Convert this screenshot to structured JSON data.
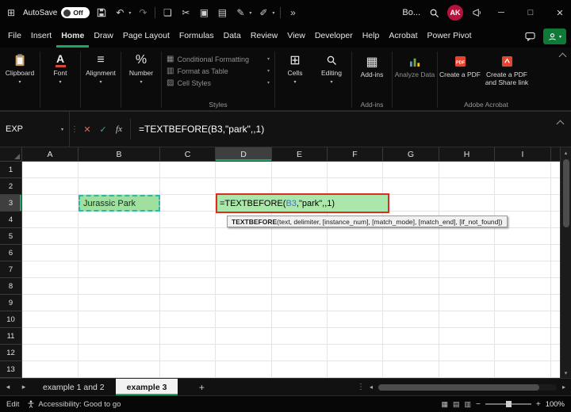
{
  "colors": {
    "accent_green": "#1EA362",
    "share_green": "#0F7937",
    "cell_fill_green": "#ABE7AB",
    "annotation_red": "#E02B20",
    "reference_blue": "#4472C4",
    "reference_border_teal": "#2AB8AD",
    "avatar_red": "#B5123C"
  },
  "titlebar": {
    "autosave_label": "AutoSave",
    "autosave_state": "Off",
    "workbook_name": "Bo...",
    "avatar_initials": "AK"
  },
  "menubar": {
    "tabs": [
      "File",
      "Insert",
      "Home",
      "Draw",
      "Page Layout",
      "Formulas",
      "Data",
      "Review",
      "View",
      "Developer",
      "Help",
      "Acrobat",
      "Power Pivot"
    ],
    "active_tab": "Home"
  },
  "ribbon": {
    "clipboard_label": "Clipboard",
    "font_label": "Font",
    "alignment_label": "Alignment",
    "number_label": "Number",
    "styles_items": [
      "Conditional Formatting",
      "Format as Table",
      "Cell Styles"
    ],
    "styles_group_label": "Styles",
    "cells_label": "Cells",
    "editing_label": "Editing",
    "addins_label": "Add-ins",
    "addins_group_label": "Add-ins",
    "analyze_label": "Analyze Data",
    "pdf_label": "Create a PDF",
    "pdf_share_label": "Create a PDF and Share link",
    "acrobat_group_label": "Adobe Acrobat"
  },
  "icons": {
    "fx": "fx",
    "font_glyph": "A",
    "number_glyph": "%"
  },
  "formula_bar": {
    "name_box_value": "EXP",
    "formula": "=TEXTBEFORE(B3,\"park\",,1)"
  },
  "grid": {
    "columns": [
      "A",
      "B",
      "C",
      "D",
      "E",
      "F",
      "G",
      "H",
      "I",
      ""
    ],
    "rows": [
      "1",
      "2",
      "3",
      "4",
      "5",
      "6",
      "7",
      "8",
      "9",
      "10",
      "11",
      "12",
      "13"
    ],
    "active_column": "D",
    "active_row": "3",
    "b3_value": "Jurassic Park",
    "d3_formula": {
      "prefix": "=TEXTBEFORE(",
      "reference": "B3",
      "suffix": ",\"park\",,1)"
    },
    "tooltip": {
      "function_name": "TEXTBEFORE",
      "signature": "(text, delimiter, [instance_num], [match_mode], [match_end], [if_not_found])"
    }
  },
  "sheet_tabs": {
    "tabs": [
      "example 1 and 2",
      "example 3"
    ],
    "active_tab": "example 3",
    "add_label": "+"
  },
  "status_bar": {
    "mode": "Edit",
    "accessibility": "Accessibility: Good to go",
    "zoom": "100%"
  }
}
